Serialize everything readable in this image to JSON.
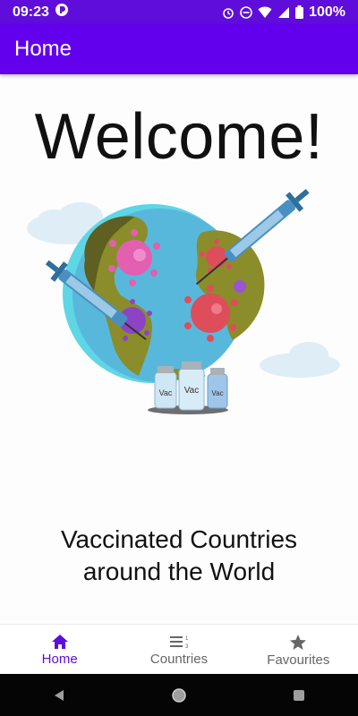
{
  "status_bar": {
    "time": "09:23",
    "battery": "100%"
  },
  "app_bar": {
    "title": "Home"
  },
  "main": {
    "welcome": "Welcome!",
    "subtitle_line1": "Vaccinated Countries",
    "subtitle_line2": "around the World",
    "vial_label": "Vac"
  },
  "bottom_nav": {
    "items": [
      {
        "label": "Home",
        "icon": "home-icon",
        "active": true
      },
      {
        "label": "Countries",
        "icon": "list-numbered-icon",
        "active": false
      },
      {
        "label": "Favourites",
        "icon": "star-icon",
        "active": false
      }
    ]
  },
  "colors": {
    "accent": "#6200ee",
    "status_bar": "#5f0ddb",
    "active_nav": "#5f0ddb"
  }
}
